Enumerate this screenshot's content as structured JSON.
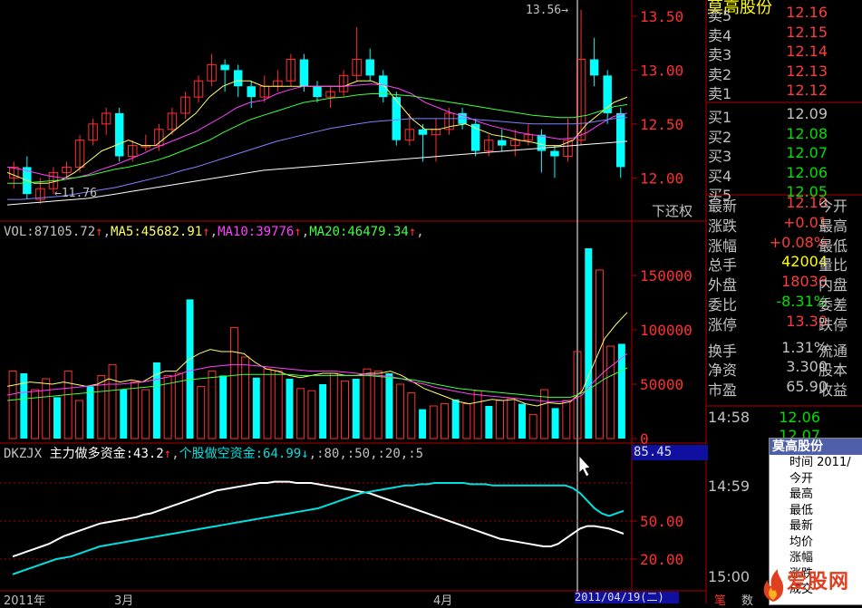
{
  "colors": {
    "up": "#ff3030",
    "down": "#00ffff",
    "ma5": "#ffff66",
    "ma10": "#ff40ff",
    "ma20": "#40ff40",
    "ma60": "#8080ff",
    "white_line": "#ffffff",
    "cyan_line": "#00e0e0",
    "axis_red": "#b00000"
  },
  "header_stock_name": "莫高股份",
  "chart_data": {
    "type": "candlestick",
    "price_high_label": "13.56",
    "price_low_label": "11.76",
    "price_ticks": [
      "13.50",
      "13.00",
      "12.50",
      "12.00"
    ],
    "price_range": [
      11.7,
      13.6
    ],
    "candles": [
      [
        12.0,
        12.1,
        12.15,
        11.9
      ],
      [
        12.1,
        11.85,
        12.2,
        11.8
      ],
      [
        11.8,
        11.9,
        12.0,
        11.76
      ],
      [
        11.9,
        12.05,
        12.1,
        11.85
      ],
      [
        12.05,
        12.1,
        12.15,
        12.0
      ],
      [
        12.1,
        12.35,
        12.4,
        12.05
      ],
      [
        12.35,
        12.5,
        12.55,
        12.3
      ],
      [
        12.5,
        12.6,
        12.65,
        12.4
      ],
      [
        12.6,
        12.2,
        12.65,
        12.15
      ],
      [
        12.2,
        12.3,
        12.35,
        12.15
      ],
      [
        12.3,
        12.3,
        12.4,
        12.25
      ],
      [
        12.3,
        12.45,
        12.5,
        12.25
      ],
      [
        12.45,
        12.6,
        12.65,
        12.4
      ],
      [
        12.6,
        12.75,
        12.8,
        12.55
      ],
      [
        12.75,
        12.9,
        12.95,
        12.7
      ],
      [
        12.9,
        13.05,
        13.15,
        12.85
      ],
      [
        13.05,
        13.0,
        13.1,
        12.8
      ],
      [
        13.0,
        12.85,
        13.05,
        12.75
      ],
      [
        12.85,
        12.75,
        12.9,
        12.65
      ],
      [
        12.75,
        12.85,
        12.95,
        12.7
      ],
      [
        12.85,
        12.9,
        13.0,
        12.8
      ],
      [
        12.9,
        13.1,
        13.15,
        12.85
      ],
      [
        13.1,
        12.85,
        13.15,
        12.8
      ],
      [
        12.85,
        12.75,
        12.9,
        12.7
      ],
      [
        12.75,
        12.8,
        12.85,
        12.65
      ],
      [
        12.8,
        12.95,
        13.0,
        12.75
      ],
      [
        12.95,
        13.1,
        13.4,
        12.9
      ],
      [
        13.1,
        12.95,
        13.2,
        12.9
      ],
      [
        12.95,
        12.75,
        13.0,
        12.7
      ],
      [
        12.75,
        12.35,
        12.8,
        12.3
      ],
      [
        12.35,
        12.45,
        12.6,
        12.3
      ],
      [
        12.45,
        12.4,
        12.5,
        12.15
      ],
      [
        12.4,
        12.45,
        12.55,
        12.15
      ],
      [
        12.45,
        12.6,
        12.65,
        12.4
      ],
      [
        12.6,
        12.5,
        12.65,
        12.45
      ],
      [
        12.5,
        12.25,
        12.55,
        12.2
      ],
      [
        12.25,
        12.35,
        12.4,
        12.2
      ],
      [
        12.35,
        12.3,
        12.45,
        12.25
      ],
      [
        12.3,
        12.35,
        12.45,
        12.2
      ],
      [
        12.35,
        12.4,
        12.5,
        12.3
      ],
      [
        12.4,
        12.25,
        12.45,
        12.05
      ],
      [
        12.25,
        12.2,
        12.3,
        12.0
      ],
      [
        12.2,
        12.35,
        12.55,
        12.15
      ],
      [
        12.35,
        13.1,
        13.56,
        12.3
      ],
      [
        13.1,
        12.95,
        13.3,
        12.85
      ],
      [
        12.95,
        12.6,
        13.0,
        12.5
      ],
      [
        12.6,
        12.1,
        12.65,
        12.0
      ]
    ],
    "ma_lines": [
      {
        "color_key": "ma5",
        "values": [
          12.05,
          12.0,
          11.95,
          11.95,
          11.98,
          12.05,
          12.15,
          12.25,
          12.3,
          12.35,
          12.3,
          12.3,
          12.4,
          12.5,
          12.6,
          12.75,
          12.85,
          12.9,
          12.9,
          12.85,
          12.85,
          12.85,
          12.85,
          12.85,
          12.85,
          12.85,
          12.9,
          12.9,
          12.85,
          12.7,
          12.55,
          12.45,
          12.45,
          12.48,
          12.5,
          12.45,
          12.4,
          12.38,
          12.35,
          12.33,
          12.3,
          12.3,
          12.35,
          12.5,
          12.6,
          12.7,
          12.75
        ]
      },
      {
        "color_key": "ma10",
        "values": [
          12.1,
          12.08,
          12.05,
          12.02,
          12.0,
          12.0,
          12.03,
          12.08,
          12.12,
          12.17,
          12.22,
          12.28,
          12.33,
          12.38,
          12.43,
          12.5,
          12.57,
          12.65,
          12.7,
          12.72,
          12.78,
          12.82,
          12.85,
          12.85,
          12.85,
          12.85,
          12.86,
          12.87,
          12.86,
          12.83,
          12.78,
          12.7,
          12.65,
          12.6,
          12.57,
          12.52,
          12.48,
          12.45,
          12.42,
          12.4,
          12.38,
          12.36,
          12.37,
          12.42,
          12.5,
          12.57,
          12.6
        ]
      },
      {
        "color_key": "ma20",
        "values": [
          11.95,
          11.95,
          11.96,
          11.97,
          11.98,
          12.0,
          12.02,
          12.05,
          12.08,
          12.1,
          12.13,
          12.16,
          12.2,
          12.25,
          12.3,
          12.35,
          12.42,
          12.48,
          12.54,
          12.58,
          12.62,
          12.66,
          12.7,
          12.72,
          12.74,
          12.75,
          12.77,
          12.78,
          12.78,
          12.77,
          12.76,
          12.74,
          12.72,
          12.7,
          12.68,
          12.66,
          12.64,
          12.62,
          12.6,
          12.58,
          12.57,
          12.56,
          12.56,
          12.58,
          12.62,
          12.66,
          12.68
        ]
      },
      {
        "color_key": "ma60",
        "values": [
          11.8,
          11.8,
          11.81,
          11.82,
          11.83,
          11.85,
          11.87,
          11.89,
          11.91,
          11.94,
          11.97,
          12.0,
          12.03,
          12.07,
          12.1,
          12.14,
          12.18,
          12.22,
          12.26,
          12.3,
          12.34,
          12.37,
          12.4,
          12.43,
          12.46,
          12.48,
          12.5,
          12.52,
          12.53,
          12.54,
          12.55,
          12.55,
          12.55,
          12.55,
          12.55,
          12.54,
          12.53,
          12.52,
          12.51,
          12.5,
          12.5,
          12.5,
          12.5,
          12.51,
          12.53,
          12.55,
          12.56
        ]
      },
      {
        "color_key": "white_line",
        "values": [
          11.75,
          11.76,
          11.77,
          11.78,
          11.79,
          11.8,
          11.81,
          11.83,
          11.85,
          11.87,
          11.89,
          11.91,
          11.93,
          11.95,
          11.97,
          11.99,
          12.01,
          12.03,
          12.05,
          12.07,
          12.08,
          12.09,
          12.1,
          12.11,
          12.12,
          12.13,
          12.14,
          12.15,
          12.16,
          12.17,
          12.18,
          12.19,
          12.2,
          12.21,
          12.22,
          12.23,
          12.24,
          12.25,
          12.26,
          12.27,
          12.28,
          12.29,
          12.3,
          12.31,
          12.32,
          12.33,
          12.34
        ]
      }
    ],
    "volume_header": {
      "vol": "VOL:87105.72",
      "ma5": "MA5:45682.91",
      "ma10": "MA10:39776",
      "ma20": "MA20:46479.34",
      "arrow": "↑",
      "sep": ","
    },
    "volume_ticks": [
      "150000",
      "100000",
      "50000",
      "0"
    ],
    "volume_range": [
      0,
      180000
    ],
    "volumes": [
      62000,
      60000,
      45000,
      55000,
      38000,
      62000,
      35000,
      48000,
      58000,
      68000,
      45000,
      52000,
      45000,
      70000,
      58000,
      60000,
      128000,
      48000,
      62000,
      58000,
      102000,
      75000,
      56000,
      64000,
      62000,
      55000,
      46000,
      44000,
      50000,
      60000,
      53000,
      55000,
      64000,
      62000,
      60000,
      50000,
      42000,
      27000,
      30000,
      32000,
      36000,
      32000,
      44000,
      30000,
      35000,
      37000,
      32000,
      22000,
      45000,
      28000,
      35000,
      80000,
      175000,
      155000,
      85000,
      87105
    ],
    "vol_ma_lines": [
      {
        "color_key": "ma5",
        "values": [
          48000,
          50000,
          52000,
          51000,
          50000,
          52000,
          50000,
          48000,
          50000,
          55000,
          52000,
          54000,
          52000,
          58000,
          62000,
          62000,
          72000,
          78000,
          82000,
          80000,
          80000,
          78000,
          70000,
          64000,
          62000,
          58000,
          56000,
          58000,
          60000,
          60000,
          58000,
          58000,
          60000,
          60000,
          62000,
          58000,
          52000,
          46000,
          42000,
          38000,
          34000,
          32000,
          34000,
          36000,
          35000,
          36000,
          32000,
          30000,
          33000,
          32000,
          34000,
          44000,
          68000,
          92000,
          105000,
          116000
        ]
      },
      {
        "color_key": "ma10",
        "values": [
          40000,
          42000,
          43000,
          44000,
          45000,
          46000,
          47000,
          48000,
          49000,
          50000,
          50000,
          51000,
          52000,
          54000,
          56000,
          58000,
          62000,
          64000,
          66000,
          67000,
          68000,
          68000,
          67000,
          66000,
          65000,
          64000,
          63000,
          62000,
          62000,
          62000,
          61000,
          60000,
          59000,
          58000,
          57000,
          55000,
          52000,
          50000,
          47000,
          45000,
          43000,
          41000,
          40000,
          39000,
          38000,
          37000,
          36000,
          35000,
          34000,
          34000,
          35000,
          40000,
          52000,
          62000,
          70000,
          78000
        ]
      },
      {
        "color_key": "ma20",
        "values": [
          35000,
          36000,
          37000,
          38000,
          39000,
          40000,
          41000,
          42000,
          43000,
          44000,
          45000,
          46000,
          47000,
          48000,
          50000,
          52000,
          54000,
          55000,
          56000,
          57000,
          58000,
          59000,
          59000,
          59000,
          59000,
          59000,
          58000,
          58000,
          58000,
          58000,
          58000,
          58000,
          58000,
          57000,
          56000,
          55000,
          54000,
          52000,
          50000,
          48000,
          46000,
          45000,
          44000,
          43000,
          42000,
          41000,
          40000,
          39000,
          38000,
          38000,
          38000,
          42000,
          48000,
          55000,
          60000,
          65000
        ]
      }
    ],
    "indicator_header": {
      "name": "DKZJX",
      "main_label": "主力做多资金:43.2",
      "arrow_up": "↑",
      "retail_label": "个股做空资金:64.99",
      "arrow_down": "↓",
      "params": ",:80,:50,:20,:5"
    },
    "indicator_value_box": "85.45",
    "indicator_ticks": [
      "50.00",
      "20.00"
    ],
    "indicator_range": [
      0,
      100
    ],
    "white_series": [
      22,
      24,
      26,
      28,
      30,
      32,
      35,
      38,
      40,
      42,
      44,
      46,
      48,
      49,
      50,
      51,
      52,
      53,
      55,
      56,
      58,
      60,
      62,
      64,
      66,
      68,
      70,
      72,
      74,
      75,
      76,
      77,
      78,
      79,
      80,
      80,
      81,
      81,
      81,
      80,
      80,
      80,
      79,
      78,
      77,
      76,
      75,
      74,
      73,
      72,
      70,
      68,
      66,
      64,
      62,
      60,
      58,
      56,
      54,
      52,
      50,
      48,
      46,
      44,
      42,
      40,
      38,
      36,
      35,
      34,
      33,
      32,
      31,
      30,
      30,
      32,
      36,
      40,
      44,
      46,
      46,
      45,
      44,
      42,
      40
    ],
    "cyan_series": [
      8,
      10,
      12,
      14,
      16,
      18,
      20,
      21,
      22,
      24,
      26,
      28,
      30,
      31,
      32,
      33,
      34,
      35,
      36,
      37,
      38,
      39,
      40,
      41,
      42,
      43,
      44,
      45,
      46,
      47,
      48,
      49,
      50,
      51,
      52,
      53,
      54,
      55,
      56,
      57,
      58,
      59,
      60,
      62,
      64,
      66,
      68,
      70,
      72,
      73,
      74,
      75,
      76,
      77,
      78,
      78,
      79,
      79,
      80,
      80,
      80,
      80,
      80,
      79,
      79,
      79,
      78,
      78,
      78,
      78,
      78,
      78,
      78,
      78,
      78,
      78,
      78,
      76,
      72,
      66,
      60,
      56,
      54,
      56,
      58
    ],
    "x_labels": [
      "2011年",
      "3月",
      "4月"
    ],
    "date_box": "2011/04/19(二)",
    "right_label_xiahuanquan": "下还权"
  },
  "order_book": {
    "sell": [
      {
        "label": "卖5",
        "price": "12.16"
      },
      {
        "label": "卖4",
        "price": "12.15"
      },
      {
        "label": "卖3",
        "price": "12.14"
      },
      {
        "label": "卖2",
        "price": "12.13"
      },
      {
        "label": "卖1",
        "price": "12.12"
      }
    ],
    "buy": [
      {
        "label": "买1",
        "price": "12.09"
      },
      {
        "label": "买2",
        "price": "12.08"
      },
      {
        "label": "买3",
        "price": "12.07"
      },
      {
        "label": "买4",
        "price": "12.06"
      },
      {
        "label": "买5",
        "price": "12.05"
      }
    ],
    "stats": [
      {
        "label": "最新",
        "value": "12.10",
        "label2": "今开",
        "color": "red"
      },
      {
        "label": "涨跌",
        "value": "+0.01",
        "label2": "最高",
        "color": "red"
      },
      {
        "label": "涨幅",
        "value": "+0.08%",
        "label2": "最低",
        "color": "red"
      },
      {
        "label": "总手",
        "value": "42004",
        "label2": "量比",
        "color": "yellow"
      },
      {
        "label": "外盘",
        "value": "18036",
        "label2": "内盘",
        "color": "red"
      },
      {
        "label": "委比",
        "value": "-8.31%",
        "label2": "委差",
        "color": "green"
      },
      {
        "label": "涨停",
        "value": "13.30",
        "label2": "跌停",
        "color": "red"
      },
      {
        "label": "换手",
        "value": "1.31%",
        "label2": "流通",
        "color": "silver"
      },
      {
        "label": "净资",
        "value": "3.300",
        "label2": "股本",
        "color": "silver"
      },
      {
        "label": "市盈",
        "value": "65.90",
        "label2": "收益",
        "color": "silver"
      }
    ],
    "ticks": [
      {
        "time": "14:58",
        "price": "12.06"
      },
      {
        "time": "",
        "price": "12.07"
      },
      {
        "time": "14:59",
        "price": ""
      },
      {
        "time": "15:00",
        "price": ""
      }
    ],
    "bottom_label": "笔",
    "bottom_label2": "数"
  },
  "popup": {
    "title": "莫高股份",
    "items": [
      "时间 2011/",
      "今开",
      "最高",
      "最低",
      "最新",
      "均价",
      "涨幅",
      "涨跌",
      "成交"
    ]
  },
  "logo": {
    "text": "爱股网"
  }
}
